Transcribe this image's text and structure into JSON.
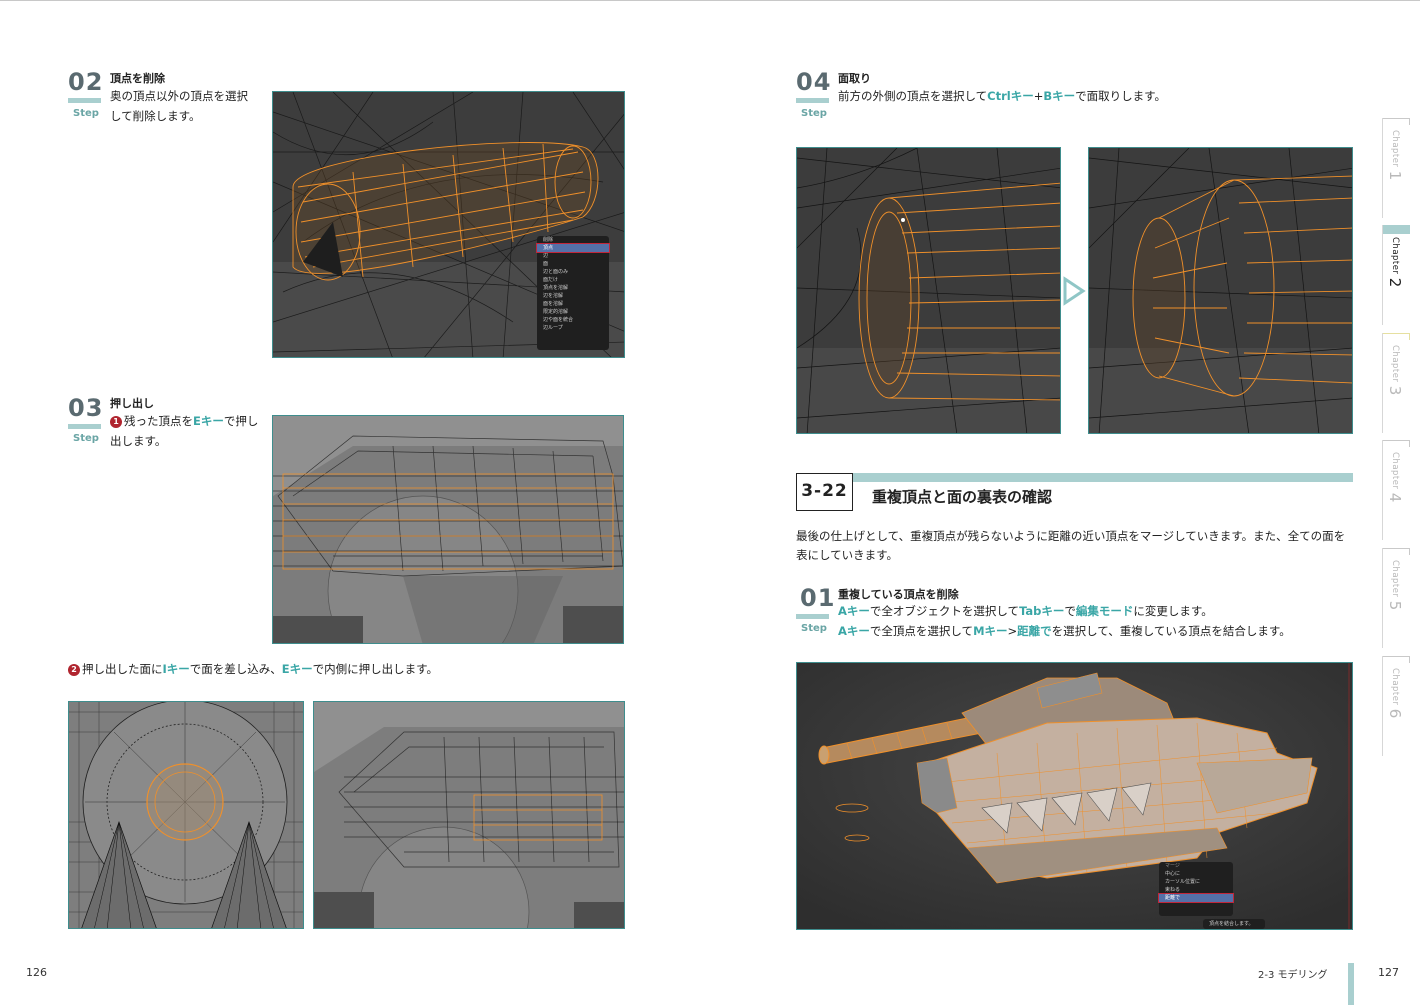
{
  "left_page": {
    "page_number": "126",
    "steps": [
      {
        "num": "02",
        "label": "Step",
        "title": "頂点を削除",
        "body_lines": [
          "奥の頂点以外の頂点を選択",
          "して削除します。"
        ]
      },
      {
        "num": "03",
        "label": "Step",
        "title": "押し出し",
        "body_marker": "1",
        "body_pre": "残った頂点を",
        "body_key": "Eキー",
        "body_post": "で押し",
        "body_line2": "出します。"
      }
    ],
    "note": {
      "marker": "2",
      "t1": "押し出した面に",
      "k1": "Iキー",
      "t2": "で面を差し込み、",
      "k2": "Eキー",
      "t3": "で内側に押し出します。"
    },
    "menu_delete": {
      "title": "削除",
      "items": [
        "頂点",
        "辺",
        "面",
        "辺と面のみ",
        "面だけ",
        "頂点を溶解",
        "辺を溶解",
        "面を溶解",
        "限定的溶解",
        "辺や面を統合",
        "辺ループ"
      ]
    }
  },
  "right_page": {
    "page_number": "127",
    "footer_section": "2-3 モデリング",
    "step04": {
      "num": "04",
      "label": "Step",
      "title": "面取り",
      "t1": "前方の外側の頂点を選択して",
      "k1": "Ctrlキー",
      "plus": "+",
      "k2": "Bキー",
      "t2": "で面取りします。"
    },
    "section": {
      "number": "3-22",
      "title": "重複頂点と面の裏表の確認",
      "paragraph": "最後の仕上げとして、重複頂点が残らないように距離の近い頂点をマージしていきます。また、全ての面を表にしていきます。"
    },
    "step01": {
      "num": "01",
      "label": "Step",
      "title": "重複している頂点を削除",
      "line1": {
        "k1": "Aキー",
        "t1": "で全オブジェクトを選択して",
        "k2": "Tabキー",
        "t2": "で",
        "k3": "編集モード",
        "t3": "に変更します。"
      },
      "line2": {
        "k1": "Aキー",
        "t1": "で全頂点を選択して",
        "k2": "Mキー",
        "t2": ">",
        "k3": "距離で",
        "t3": "を選択して、重複している頂点を結合します。"
      }
    },
    "menu_merge": {
      "title": "マージ",
      "items": [
        "中心に",
        "カーソル位置に",
        "束ねる",
        "距離で"
      ],
      "status": "頂点を結合します。"
    }
  },
  "chapters": [
    {
      "label": "Chapter",
      "num": "1",
      "active": false
    },
    {
      "label": "Chapter",
      "num": "2",
      "active": true
    },
    {
      "label": "Chapter",
      "num": "3",
      "active": false
    },
    {
      "label": "Chapter",
      "num": "4",
      "active": false
    },
    {
      "label": "Chapter",
      "num": "5",
      "active": false
    },
    {
      "label": "Chapter",
      "num": "6",
      "active": false
    }
  ],
  "colors": {
    "accent": "#3aa6a6",
    "step_bar": "#a9cfcf",
    "mesh_orange": "#f0902a",
    "viewport_bg": "#3b3b3b",
    "marker_red": "#b0252f"
  }
}
